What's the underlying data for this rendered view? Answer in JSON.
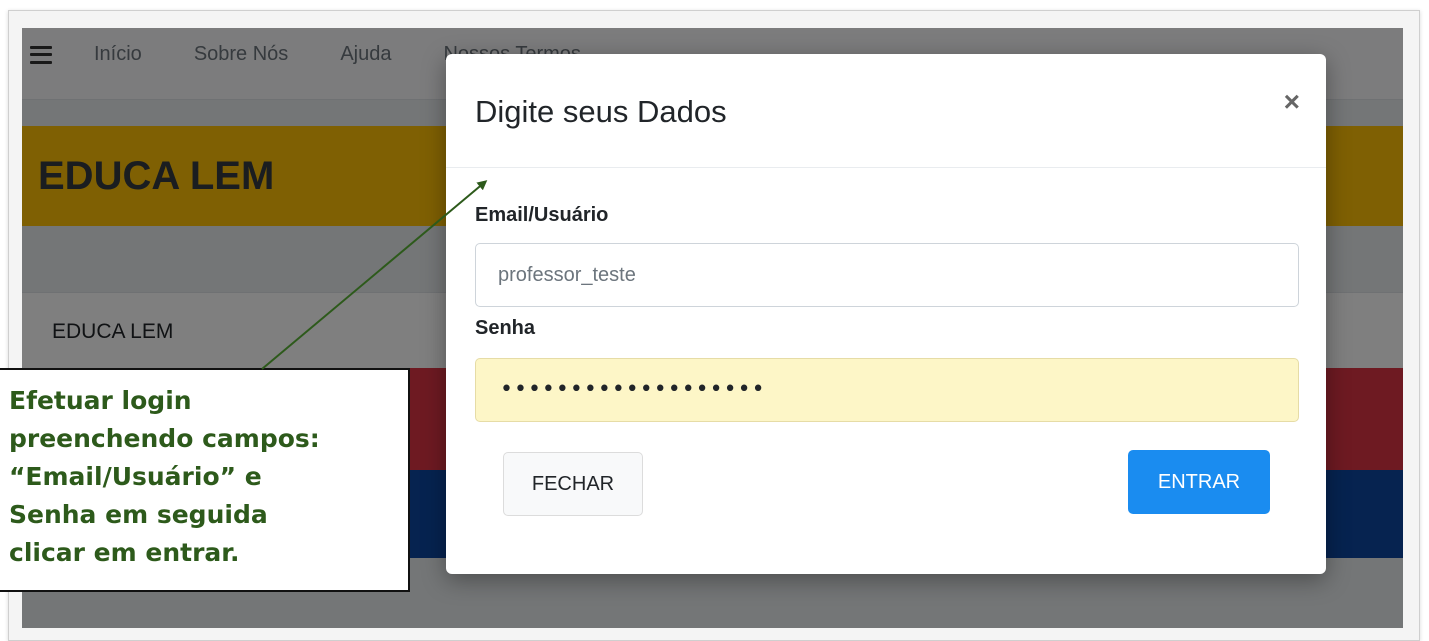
{
  "navbar": {
    "menu_icon": "hamburger-menu-icon",
    "links": [
      "Início",
      "Sobre Nós",
      "Ajuda",
      "Nossos Termos"
    ]
  },
  "banner": {
    "title": "EDUCA LEM"
  },
  "subbar": {
    "title": "EDUCA LEM"
  },
  "modal": {
    "title": "Digite seus Dados",
    "close_symbol": "×",
    "email_label": "Email/Usuário",
    "email_value": "professor_teste",
    "password_label": "Senha",
    "password_mask": "•••••••••••••••••••",
    "cancel_label": "FECHAR",
    "submit_label": "ENTRAR"
  },
  "annotation": {
    "text": "Efetuar login\npreenchendo campos:\n“Email/Usuário” e\nSenha em seguida\nclicar em entrar."
  },
  "colors": {
    "banner_yellow": "#ffc107",
    "band_red": "#dc3545",
    "band_blue": "#0d47a1",
    "primary_button": "#1a8cf0",
    "annotation_green": "#2d5a1b",
    "password_autofill": "#fdf6c7"
  }
}
